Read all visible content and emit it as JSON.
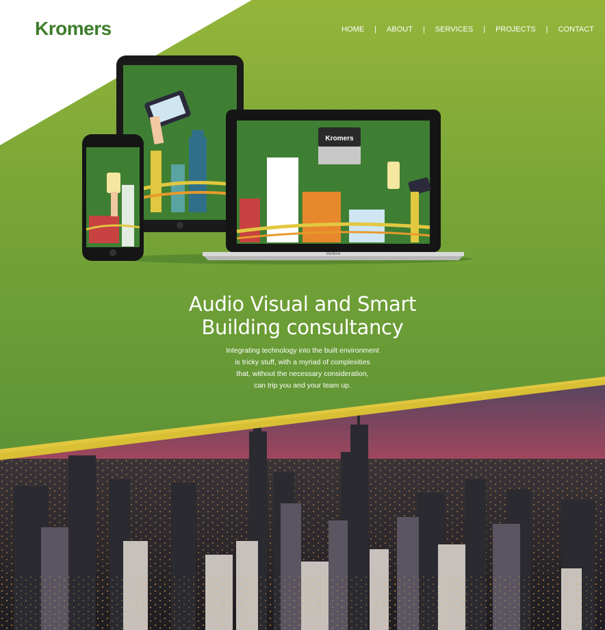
{
  "brand": {
    "logo_text": "Kromers"
  },
  "nav": {
    "items": [
      {
        "label": "HOME"
      },
      {
        "label": "ABOUT"
      },
      {
        "label": "SERVICES"
      },
      {
        "label": "PROJECTS"
      },
      {
        "label": "CONTACT"
      }
    ],
    "separator": "|"
  },
  "hero": {
    "headline_line1": "Audio Visual and Smart",
    "headline_line2": "Building consultancy",
    "body_lines": [
      "Integrating technology into the built environment",
      "is tricky stuff, with a myriad of complexities",
      "that, without the necessary consideration,",
      "can trip you and your team up."
    ]
  },
  "mockup": {
    "laptop_screen_brand": "Kromers",
    "laptop_model": "MacBook"
  },
  "colors": {
    "green_dark": "#3d7d2a",
    "green_mid": "#6f9d35",
    "green_light": "#94b53a",
    "accent_yellow": "#e2c840",
    "white": "#ffffff"
  }
}
